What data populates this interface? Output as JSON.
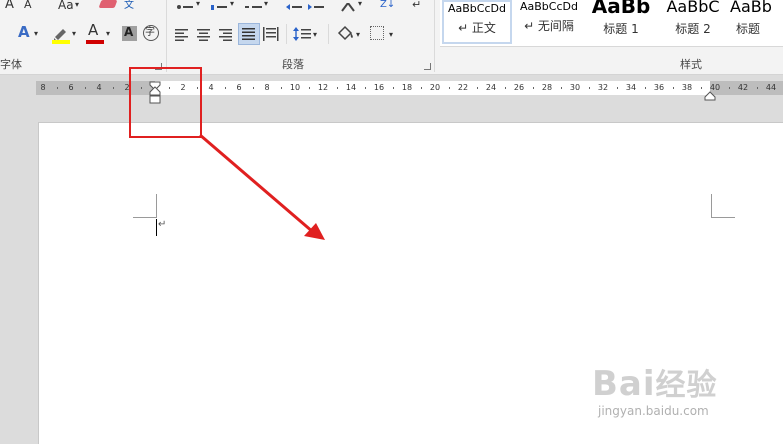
{
  "ribbon": {
    "font_group": {
      "label": "字体",
      "grow_font_label": "A",
      "shrink_font_label": "A",
      "change_case_label": "Aa",
      "phonetic_label": "文",
      "text_effects_label": "A",
      "font_color_label": "A",
      "char_shading_label": "A",
      "enclose_char_label": "字"
    },
    "paragraph_group": {
      "label": "段落",
      "sort_label": "Z↓",
      "show_marks_label": "↵"
    },
    "styles_group": {
      "label": "样式",
      "styles": [
        {
          "sample": "AaBbCcDd",
          "name": "↵ 正文",
          "selected": true
        },
        {
          "sample": "AaBbCcDd",
          "name": "↵ 无间隔",
          "selected": false
        },
        {
          "sample": "AaBb",
          "name": "标题 1",
          "selected": false
        },
        {
          "sample": "AaBbC",
          "name": "标题 2",
          "selected": false
        },
        {
          "sample": "AaBb",
          "name": "标题",
          "selected": false
        }
      ]
    }
  },
  "ruler": {
    "labels_left": [
      "8",
      "6",
      "4",
      "2"
    ],
    "labels_right": [
      "2",
      "4",
      "6",
      "8",
      "10",
      "12",
      "14",
      "16",
      "18",
      "20",
      "22",
      "24",
      "26",
      "28",
      "30",
      "32",
      "34",
      "36",
      "38",
      "40",
      "42",
      "44"
    ]
  },
  "document": {
    "paragraph_mark": "↵"
  },
  "watermark": {
    "logo_text": "Bai",
    "logo_suffix": "经验",
    "url": "jingyan.baidu.com"
  },
  "colors": {
    "highlight": "#e02020",
    "ribbon_bg": "#f3f3f3",
    "workspace_bg": "#dcdcdc",
    "selected_style_border": "#c5d7ee",
    "highlight_yellow": "#ffff00",
    "font_color_red": "#d00000"
  }
}
